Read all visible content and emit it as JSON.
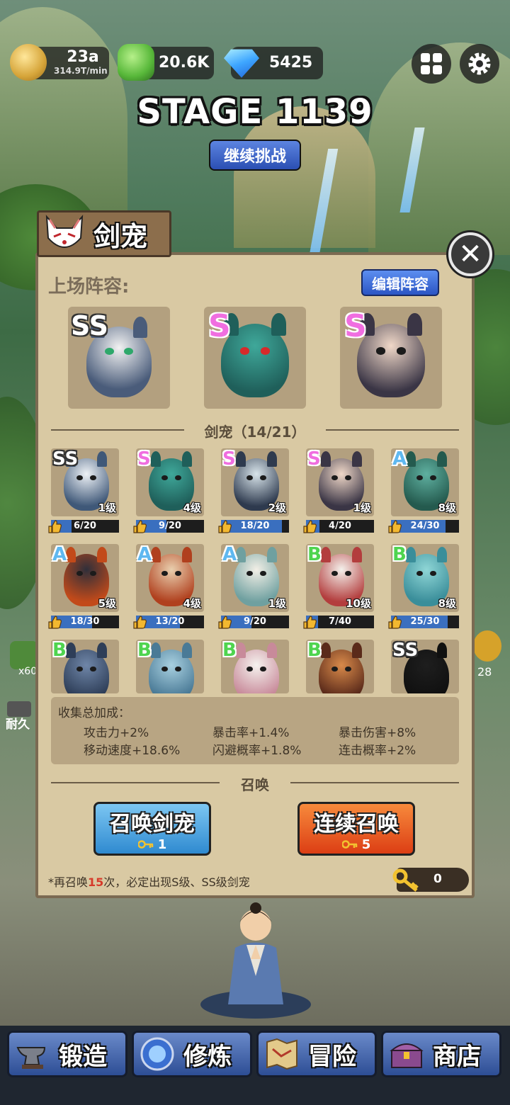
{
  "resources": {
    "gold": {
      "value": "23a",
      "rate": "314.9T/min"
    },
    "jade": {
      "value": "20.6K"
    },
    "gems": {
      "value": "5425"
    }
  },
  "stage": {
    "title": "STAGE 1139",
    "continue_label": "继续挑战"
  },
  "panel": {
    "tab_title": "剑宠",
    "lineup_label": "上场阵容:",
    "edit_label": "编辑阵容",
    "lineup": [
      {
        "grade": "SS"
      },
      {
        "grade": "S"
      },
      {
        "grade": "S"
      }
    ],
    "collection_title": "剑宠（14/21）",
    "pets": [
      {
        "grade": "SS",
        "level": "1级",
        "progress": "6/20"
      },
      {
        "grade": "S",
        "level": "4级",
        "progress": "9/20"
      },
      {
        "grade": "S",
        "level": "2级",
        "progress": "18/20"
      },
      {
        "grade": "S",
        "level": "1级",
        "progress": "4/20"
      },
      {
        "grade": "A",
        "level": "8级",
        "progress": "24/30"
      },
      {
        "grade": "A",
        "level": "5级",
        "progress": "18/30"
      },
      {
        "grade": "A",
        "level": "4级",
        "progress": "13/20"
      },
      {
        "grade": "A",
        "level": "1级",
        "progress": "9/20"
      },
      {
        "grade": "B",
        "level": "10级",
        "progress": "7/40"
      },
      {
        "grade": "B",
        "level": "8级",
        "progress": "25/30"
      },
      {
        "grade": "B"
      },
      {
        "grade": "B"
      },
      {
        "grade": "B"
      },
      {
        "grade": "B"
      },
      {
        "grade": "SS"
      }
    ],
    "bonus": {
      "title": "收集总加成：",
      "items": [
        "攻击力+2%",
        "暴击率+1.4%",
        "暴击伤害+8%",
        "移动速度+18.6%",
        "闪避概率+1.8%",
        "连击概率+2%"
      ]
    },
    "summon_section": "召唤",
    "summon_one": {
      "label": "召唤剑宠",
      "cost": "1"
    },
    "summon_multi": {
      "label": "连续召唤",
      "cost": "5"
    },
    "note_prefix": "*再召唤",
    "note_count": "15",
    "note_suffix": "次，必定出现S级、SS级剑宠",
    "key_count": "0"
  },
  "side": {
    "left_count": "x60",
    "left_label": "耐久",
    "right_count": "28"
  },
  "nav": [
    {
      "label": "锻造",
      "icon": "anvil-icon"
    },
    {
      "label": "修炼",
      "icon": "orb-icon"
    },
    {
      "label": "冒险",
      "icon": "map-icon"
    },
    {
      "label": "商店",
      "icon": "chest-icon"
    }
  ],
  "colors": {
    "panel_bg": "#d9c9a3",
    "summon_one": "#4aa6e0",
    "summon_multi": "#ec5a1e",
    "grade_s": "#f06ee0",
    "grade_a": "#5fb8f0",
    "grade_b": "#4fd44f"
  }
}
